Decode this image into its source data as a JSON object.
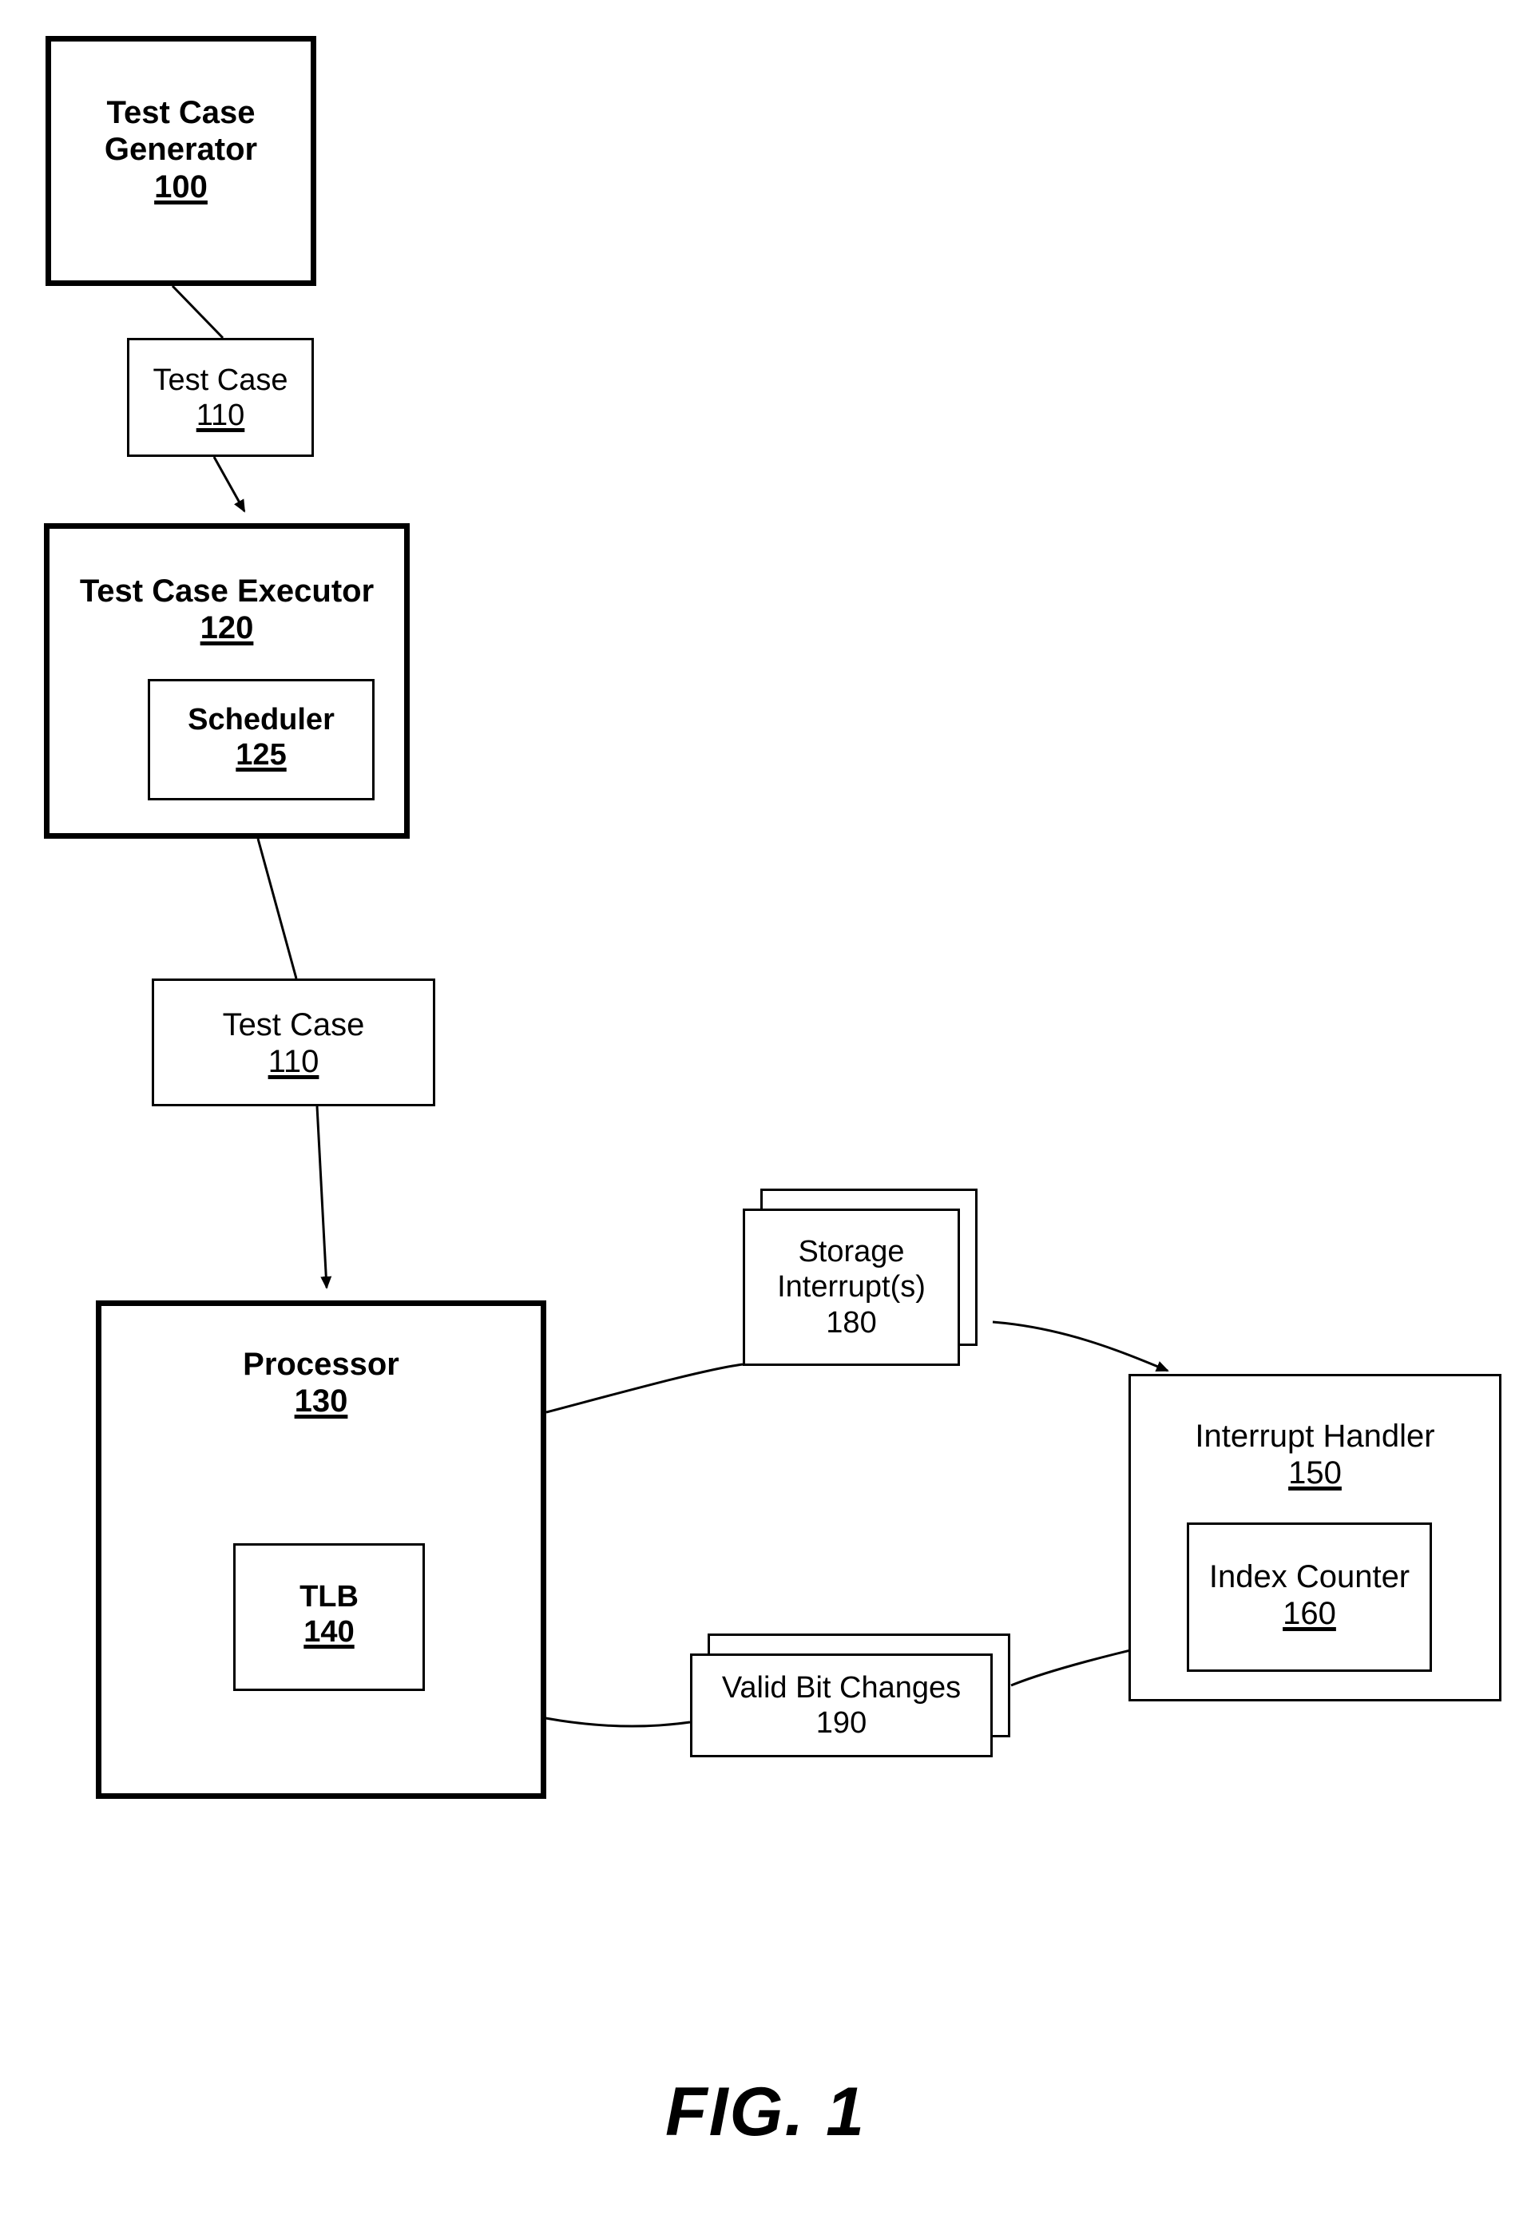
{
  "figure": {
    "caption": "FIG. 1",
    "ink_color": "#000000",
    "background_color": "#ffffff"
  },
  "nodes": {
    "generator": {
      "title": "Test Case Generator",
      "title_line1": "Test Case",
      "title_line2": "Generator",
      "ref": "100"
    },
    "testcase_1": {
      "title": "Test Case",
      "ref": "110"
    },
    "executor": {
      "title": "Test Case Executor",
      "ref": "120"
    },
    "scheduler": {
      "title": "Scheduler",
      "ref": "125"
    },
    "testcase_2": {
      "title": "Test Case",
      "ref": "110"
    },
    "processor": {
      "title": "Processor",
      "ref": "130"
    },
    "tlb": {
      "title": "TLB",
      "ref": "140"
    },
    "storage_interrupts": {
      "title": "Storage Interrupt(s)",
      "title_line1": "Storage",
      "title_line2": "Interrupt(s)",
      "ref": "180"
    },
    "interrupt_handler": {
      "title": "Interrupt Handler",
      "ref": "150"
    },
    "index_counter": {
      "title": "Index Counter",
      "ref": "160"
    },
    "valid_bit_changes": {
      "title": "Valid Bit Changes",
      "ref": "190"
    }
  },
  "connectors": [
    {
      "name": "generator-to-testcase-1",
      "from": "generator",
      "to": "testcase_1",
      "arrow": false
    },
    {
      "name": "testcase-1-to-executor",
      "from": "testcase_1",
      "to": "executor",
      "arrow": true
    },
    {
      "name": "executor-to-testcase-2",
      "from": "executor",
      "to": "testcase_2",
      "arrow": false
    },
    {
      "name": "testcase-2-to-processor",
      "from": "testcase_2",
      "to": "processor",
      "arrow": true
    },
    {
      "name": "processor-to-storage-interrupts",
      "from": "processor",
      "to": "storage_interrupts",
      "arrow": false
    },
    {
      "name": "storage-interrupts-to-interrupt-handler",
      "from": "storage_interrupts",
      "to": "interrupt_handler",
      "arrow": true
    },
    {
      "name": "index-counter-to-valid-bit-changes",
      "from": "index_counter",
      "to": "valid_bit_changes",
      "arrow": false
    },
    {
      "name": "valid-bit-changes-to-tlb",
      "from": "valid_bit_changes",
      "to": "tlb",
      "arrow": true
    }
  ]
}
